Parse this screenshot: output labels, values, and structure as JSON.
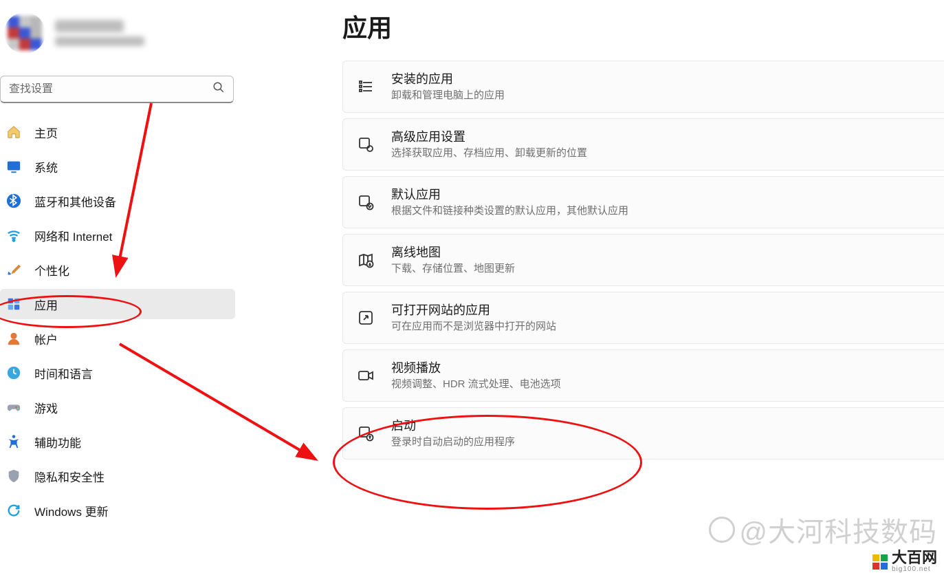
{
  "profile": {
    "name_blur": true,
    "email_blur": true
  },
  "search": {
    "placeholder": "查找设置"
  },
  "nav": [
    {
      "label": "主页"
    },
    {
      "label": "系统"
    },
    {
      "label": "蓝牙和其他设备"
    },
    {
      "label": "网络和 Internet"
    },
    {
      "label": "个性化"
    },
    {
      "label": "应用",
      "selected": true
    },
    {
      "label": "帐户"
    },
    {
      "label": "时间和语言"
    },
    {
      "label": "游戏"
    },
    {
      "label": "辅助功能"
    },
    {
      "label": "隐私和安全性"
    },
    {
      "label": "Windows 更新"
    }
  ],
  "page": {
    "title": "应用"
  },
  "cards": [
    {
      "title": "安装的应用",
      "desc": "卸载和管理电脑上的应用"
    },
    {
      "title": "高级应用设置",
      "desc": "选择获取应用、存档应用、卸载更新的位置"
    },
    {
      "title": "默认应用",
      "desc": "根据文件和链接种类设置的默认应用，其他默认应用"
    },
    {
      "title": "离线地图",
      "desc": "下载、存储位置、地图更新"
    },
    {
      "title": "可打开网站的应用",
      "desc": "可在应用而不是浏览器中打开的网站"
    },
    {
      "title": "视频播放",
      "desc": "视频调整、HDR 流式处理、电池选项"
    },
    {
      "title": "启动",
      "desc": "登录时自动启动的应用程序"
    }
  ],
  "watermark": {
    "text": "@大河科技数码"
  },
  "site": {
    "name": "大百网",
    "domain": "big100.net"
  }
}
